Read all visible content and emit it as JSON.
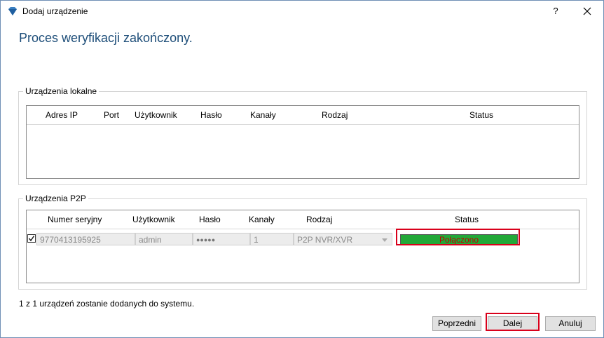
{
  "window": {
    "title": "Dodaj urządzenie",
    "help_label": "?",
    "close_label": "✕"
  },
  "heading": "Proces weryfikacji zakończony.",
  "local": {
    "group_label": "Urządzenia lokalne",
    "columns": [
      "Adres IP",
      "Port",
      "Użytkownik",
      "Hasło",
      "Kanały",
      "Rodzaj",
      "Status"
    ]
  },
  "p2p": {
    "group_label": "Urządzenia P2P",
    "columns": [
      "Numer seryjny",
      "Użytkownik",
      "Hasło",
      "Kanały",
      "Rodzaj",
      "Status"
    ],
    "rows": [
      {
        "checked": true,
        "serial": "9770413195925",
        "user": "admin",
        "password": "●●●●●",
        "channels": "1",
        "type": "P2P NVR/XVR",
        "status": "Połączono"
      }
    ]
  },
  "footer_text": "1 z 1 urządzeń zostanie dodanych do systemu.",
  "buttons": {
    "prev": "Poprzedni",
    "next": "Dalej",
    "cancel": "Anuluj"
  },
  "colors": {
    "heading": "#1e4e79",
    "status_ok": "#22a838",
    "highlight": "#d9001b"
  }
}
